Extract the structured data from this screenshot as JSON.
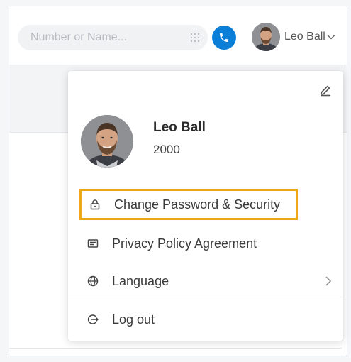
{
  "header": {
    "search_placeholder": "Number or Name...",
    "user_name": "Leo Ball"
  },
  "profile": {
    "name": "Leo Ball",
    "extension": "2000"
  },
  "menu": {
    "items": [
      {
        "label": "Change Password & Security",
        "icon": "lock-icon",
        "highlighted": true
      },
      {
        "label": "Privacy Policy Agreement",
        "icon": "id-card-icon"
      },
      {
        "label": "Language",
        "icon": "globe-icon"
      },
      {
        "label": "Log out",
        "icon": "logout-icon"
      }
    ]
  },
  "colors": {
    "accent": "#0b7fd8",
    "highlight_border": "#f0a81a"
  }
}
